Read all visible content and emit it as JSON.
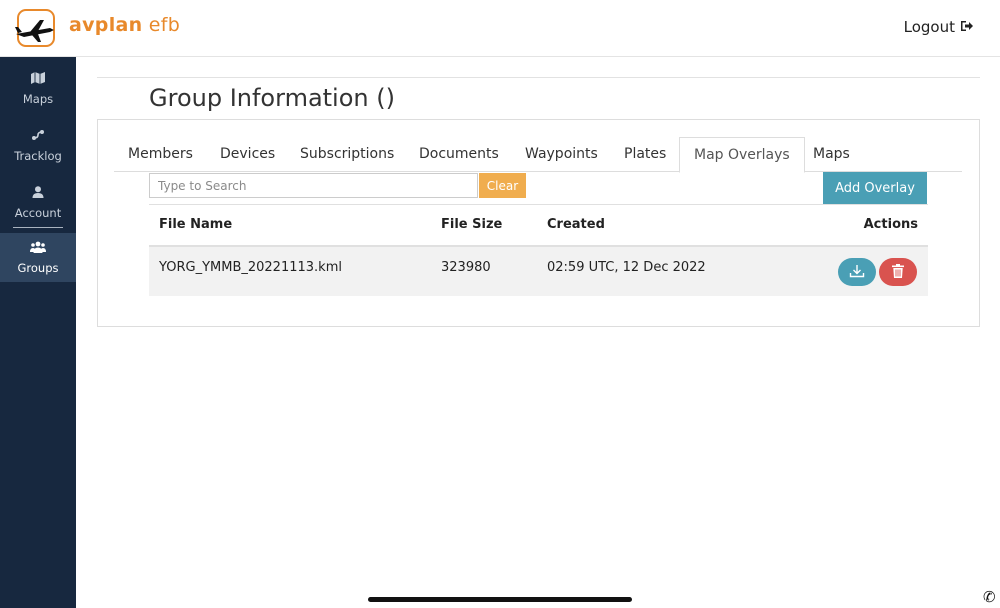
{
  "header": {
    "brand_part1": "avplan",
    "brand_part2": " efb",
    "logout_label": "Logout"
  },
  "sidebar": {
    "items": [
      {
        "label": "Maps",
        "icon": "map-icon"
      },
      {
        "label": "Tracklog",
        "icon": "tracklog-icon"
      },
      {
        "label": "Account",
        "icon": "user-icon"
      },
      {
        "label": "Groups",
        "icon": "users-icon",
        "active": true
      }
    ]
  },
  "page": {
    "title": "Group Information ()"
  },
  "tabs": [
    {
      "label": "Members"
    },
    {
      "label": "Devices"
    },
    {
      "label": "Subscriptions"
    },
    {
      "label": "Documents"
    },
    {
      "label": "Waypoints"
    },
    {
      "label": "Plates"
    },
    {
      "label": "Map Overlays",
      "active": true
    },
    {
      "label": "Maps"
    }
  ],
  "toolbar": {
    "search_placeholder": "Type to Search",
    "search_value": "",
    "clear_label": "Clear",
    "add_label": "Add Overlay"
  },
  "table": {
    "headers": [
      "File Name",
      "File Size",
      "Created",
      "Actions"
    ],
    "rows": [
      {
        "file_name": "YORG_YMMB_20221113.kml",
        "file_size": "323980",
        "created": "02:59 UTC, 12 Dec 2022"
      }
    ]
  },
  "colors": {
    "brand_orange": "#e8892b",
    "sidebar_bg": "#17283f",
    "sidebar_active": "#2f4560",
    "accent_blue": "#4a9fb5",
    "clear_orange": "#f0ad4e",
    "danger_red": "#d9534f"
  }
}
